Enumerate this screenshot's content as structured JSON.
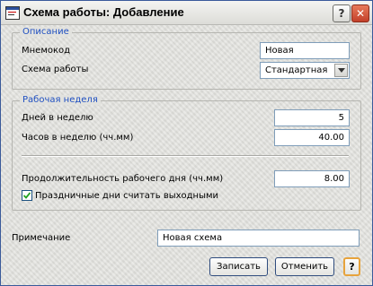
{
  "window": {
    "title": "Схема работы: Добавление",
    "help_glyph": "?",
    "close_glyph": "✕"
  },
  "description": {
    "legend": "Описание",
    "mnemocode_label": "Мнемокод",
    "mnemocode_value": "Новая",
    "schema_label": "Схема работы",
    "schema_value": "Стандартная"
  },
  "work_week": {
    "legend": "Рабочая неделя",
    "days_label": "Дней в неделю",
    "days_value": "5",
    "hours_label": "Часов в неделю (чч.мм)",
    "hours_value": "40.00",
    "day_length_label": "Продолжительность рабочего дня (чч.мм)",
    "day_length_value": "8.00",
    "holidays_label": "Праздничные дни считать выходными",
    "holidays_checked": true
  },
  "note": {
    "label": "Примечание",
    "value": "Новая схема"
  },
  "buttons": {
    "save_label": "Записать",
    "cancel_label": "Отменить",
    "help_label": "?"
  },
  "colors": {
    "legend": "#1f4fc1",
    "help_button_border": "#e7a33c",
    "close_button": "#c2402a"
  }
}
